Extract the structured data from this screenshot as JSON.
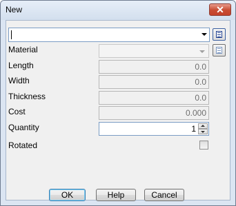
{
  "window": {
    "title": "New",
    "close_glyph": "✕"
  },
  "name_field": {
    "value": ""
  },
  "fields": {
    "material": {
      "label": "Material",
      "value": ""
    },
    "length": {
      "label": "Length",
      "value": "0.0"
    },
    "width": {
      "label": "Width",
      "value": "0.0"
    },
    "thickness": {
      "label": "Thickness",
      "value": "0.0"
    },
    "cost": {
      "label": "Cost",
      "value": "0.000"
    },
    "quantity": {
      "label": "Quantity",
      "value": "1"
    },
    "rotated": {
      "label": "Rotated",
      "checked": false
    }
  },
  "buttons": {
    "ok": "OK",
    "help": "Help",
    "cancel": "Cancel"
  },
  "icons": [
    "close-icon",
    "list-icon",
    "dropdown-arrow-icon",
    "spin-up-icon",
    "spin-down-icon"
  ]
}
